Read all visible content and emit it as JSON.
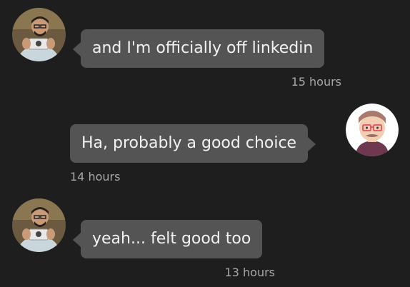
{
  "colors": {
    "background": "#1e1e1e",
    "bubble": "#545454",
    "text": "#f2f2f2",
    "timestamp": "#a8a8a8"
  },
  "messages": [
    {
      "sender": "other",
      "avatar": "avatar-photo-icon",
      "text": "and I'm officially off linkedin",
      "time": "15 hours"
    },
    {
      "sender": "me",
      "avatar": "avatar-illustrated-icon",
      "text": "Ha, probably a good choice",
      "time": "14 hours"
    },
    {
      "sender": "other",
      "avatar": "avatar-photo-icon",
      "text": "yeah... felt good too",
      "time": "13 hours"
    }
  ]
}
